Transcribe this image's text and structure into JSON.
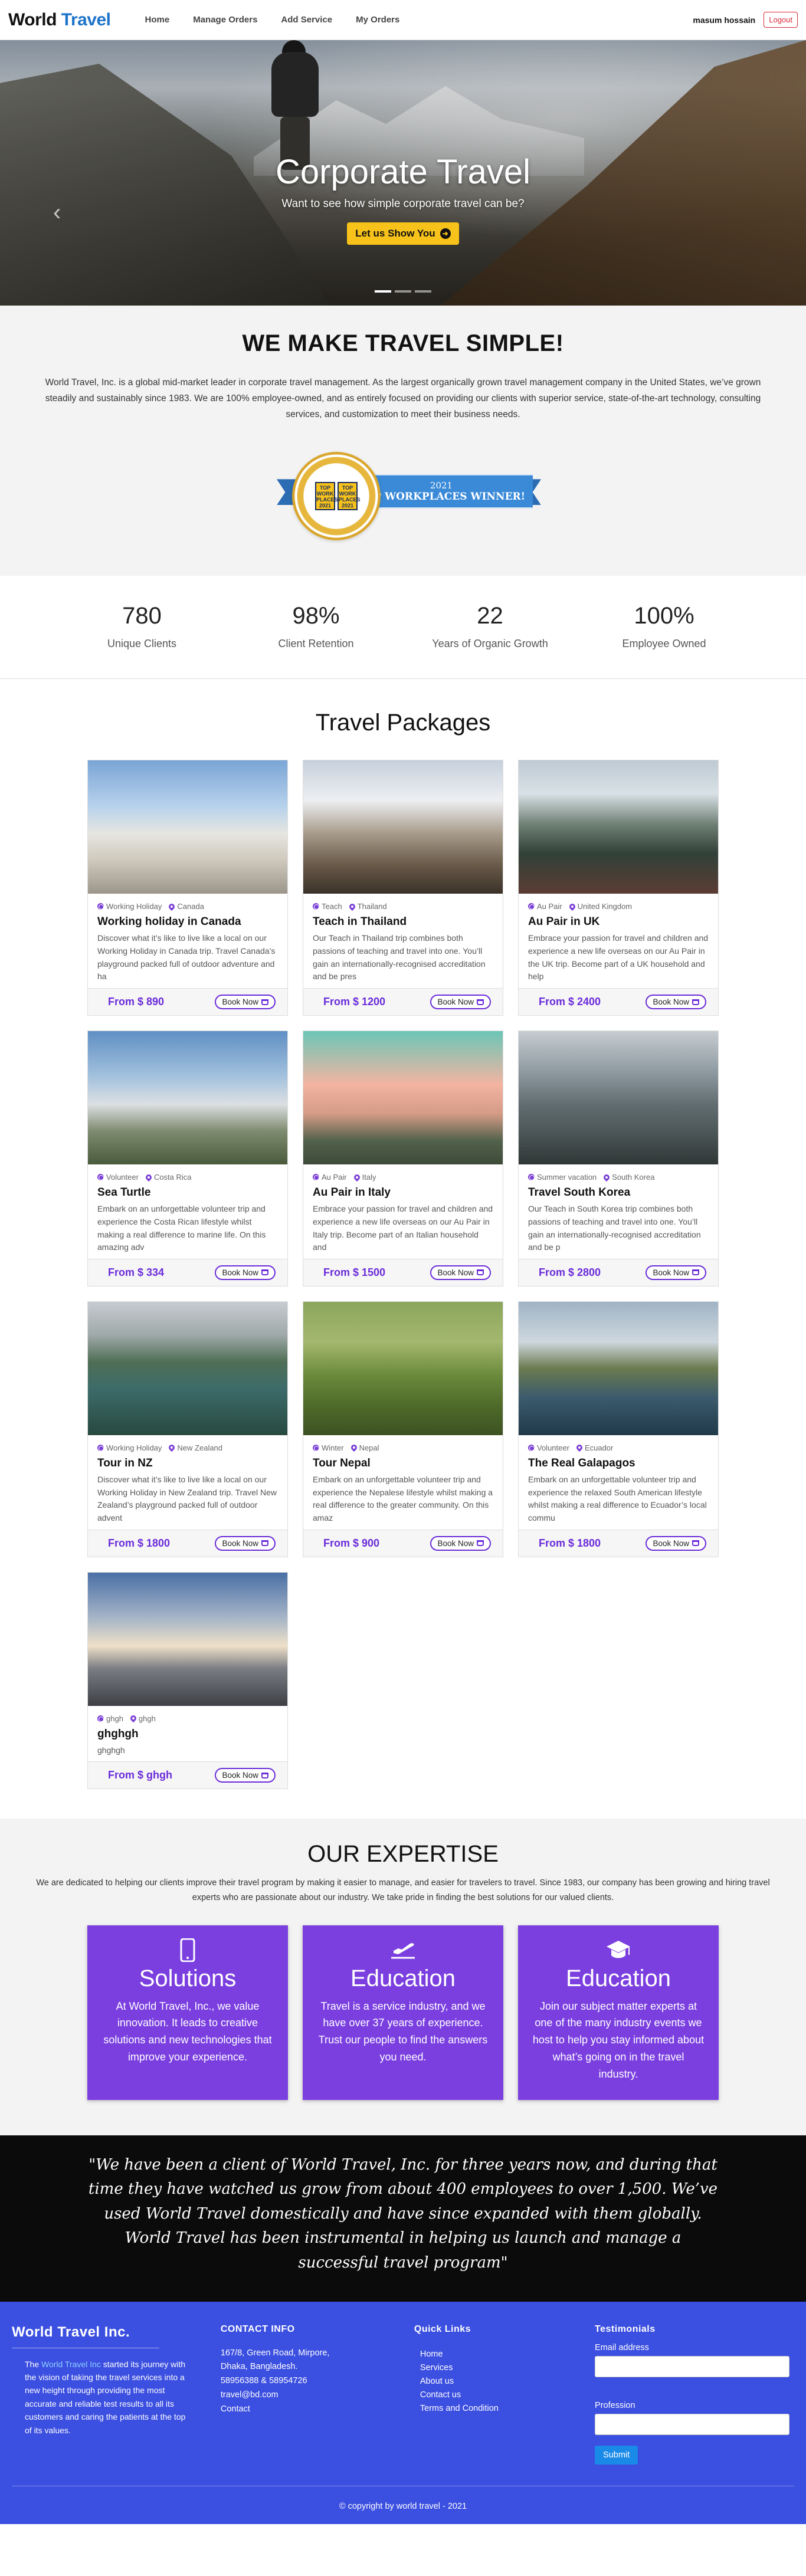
{
  "navbar": {
    "brand_part1": "World",
    "brand_part2": "Travel",
    "links": [
      "Home",
      "Manage Orders",
      "Add Service",
      "My Orders"
    ],
    "username": "masum hossain",
    "logout_label": "Logout"
  },
  "hero": {
    "title": "Corporate Travel",
    "subtitle": "Want to see how simple corporate travel can be?",
    "cta_label": "Let us Show You",
    "prev_glyph": "‹"
  },
  "about": {
    "heading": "WE MAKE TRAVEL SIMPLE!",
    "text": "World Travel, Inc. is a global mid-market leader in corporate travel management. As the largest organically grown travel management company in the United States, we’ve grown steadily and sustainably since 1983. We are 100% employee-owned, and as entirely focused on providing our clients with superior service, state-of-the-art technology, consulting services, and customization to meet their business needs.",
    "award_year": "2021",
    "award_text": "TOP WORKPLACES WINNER!",
    "award_tile1": "TOP WORK PLACES 2021",
    "award_tile2": "TOP WORK PLACES 2021"
  },
  "stats": [
    {
      "value": "780",
      "label": "Unique Clients"
    },
    {
      "value": "98%",
      "label": "Client Retention"
    },
    {
      "value": "22",
      "label": "Years of Organic Growth"
    },
    {
      "value": "100%",
      "label": "Employee Owned"
    }
  ],
  "packages": {
    "heading": "Travel Packages",
    "book_label": "Book Now",
    "items": [
      {
        "category": "Working Holiday",
        "location": "Canada",
        "title": "Working holiday in Canada",
        "desc": "Discover what it’s like to live like a local on our Working Holiday in Canada trip. Travel Canada’s playground packed full of outdoor adventure and ha",
        "price": "From $ 890"
      },
      {
        "category": "Teach",
        "location": "Thailand",
        "title": "Teach in Thailand",
        "desc": "Our Teach in Thailand trip combines both passions of teaching and travel into one. You’ll gain an internationally-recognised accreditation and be pres",
        "price": "From $ 1200"
      },
      {
        "category": "Au Pair",
        "location": "United Kingdom",
        "title": "Au Pair in UK",
        "desc": "Embrace your passion for travel and children and experience a new life overseas on our Au Pair in the UK trip. Become part of a UK household and help",
        "price": "From $ 2400"
      },
      {
        "category": "Volunteer",
        "location": "Costa Rica",
        "title": "Sea Turtle",
        "desc": "Embark on an unforgettable volunteer trip and experience the Costa Rican lifestyle whilst making a real difference to marine life. On this amazing adv",
        "price": "From $ 334"
      },
      {
        "category": "Au Pair",
        "location": "Italy",
        "title": "Au Pair in Italy",
        "desc": "Embrace your passion for travel and children and experience a new life overseas on our Au Pair in Italy trip. Become part of an Italian household and",
        "price": "From $ 1500"
      },
      {
        "category": "Summer vacation",
        "location": "South Korea",
        "title": "Travel South Korea",
        "desc": "Our Teach in South Korea trip combines both passions of teaching and travel into one. You’ll gain an internationally-recognised accreditation and be p",
        "price": "From $ 2800"
      },
      {
        "category": "Working Holiday",
        "location": "New Zealand",
        "title": "Tour in NZ",
        "desc": "Discover what it’s like to live like a local on our Working Holiday in New Zealand trip. Travel New Zealand’s playground packed full of outdoor advent",
        "price": "From $ 1800"
      },
      {
        "category": "Winter",
        "location": "Nepal",
        "title": "Tour Nepal",
        "desc": "Embark on an unforgettable volunteer trip and experience the Nepalese lifestyle whilst making a real difference to the greater community. On this amaz",
        "price": "From $ 900"
      },
      {
        "category": "Volunteer",
        "location": "Ecuador",
        "title": "The Real Galapagos",
        "desc": "Embark on an unforgettable volunteer trip and experience the relaxed South American lifestyle whilst making a real difference to Ecuador’s local commu",
        "price": "From $ 1800"
      },
      {
        "category": "ghgh",
        "location": "ghgh",
        "title": "ghghgh",
        "desc": "ghghgh",
        "price": "From $ ghgh"
      }
    ]
  },
  "expertise": {
    "heading": "OUR EXPERTISE",
    "text": "We are dedicated to helping our clients improve their travel program by making it easier to manage, and easier for travelers to travel. Since 1983, our company has been growing and hiring travel experts who are passionate about our industry. We take pride in finding the best solutions for our valued clients.",
    "cards": [
      {
        "icon": "mobile-icon",
        "title": "Solutions",
        "text": "At World Travel, Inc., we value innovation. It leads to creative solutions and new technologies that improve your experience."
      },
      {
        "icon": "plane-departure-icon",
        "title": "Education",
        "text": "Travel is a service industry, and we have over 37 years of experience. Trust our people to find the answers you need."
      },
      {
        "icon": "graduation-cap-icon",
        "title": "Education",
        "text": "Join our subject matter experts at one of the many industry events we host to help you stay informed about what’s going on in the travel industry."
      }
    ]
  },
  "testimonial": {
    "text": "\"We have been a client of World Travel, Inc. for three years now, and during that time they have watched us grow from about 400 employees to over 1,500. We’ve used World Travel domestically and have since expanded with them globally. World Travel has been instrumental in helping us launch and manage a successful travel program\""
  },
  "footer": {
    "company_heading": "World Travel Inc.",
    "about_prefix": "The",
    "about_highlight": "World Travel Inc",
    "about_rest": "started its journey with the vision of taking the travel services into a new height through providing the most accurate and reliable test results to all its customers and caring the patients at the top of its values.",
    "contact_heading": "CONTACT INFO",
    "contact_address": "167/8, Green Road, Mirpore, Dhaka, Bangladesh.",
    "contact_phone": "58956388 & 58954726",
    "contact_email": "travel@bd.com",
    "contact_link": "Contact",
    "links_heading": "Quick Links",
    "links": [
      "Home",
      "Services",
      "About us",
      "Contact us",
      "Terms and Condition"
    ],
    "testimonials_heading": "Testimonials",
    "email_label": "Email address",
    "profession_label": "Profession",
    "submit_label": "Submit",
    "copyright": "© copyright by world travel - 2021"
  },
  "colors": {
    "accent_purple": "#6a2bd9",
    "expertise_card": "#7b3fe0",
    "footer_bg": "#3b4fe0",
    "cta_yellow": "#f7c21a",
    "brand_blue": "#1e74c9"
  }
}
